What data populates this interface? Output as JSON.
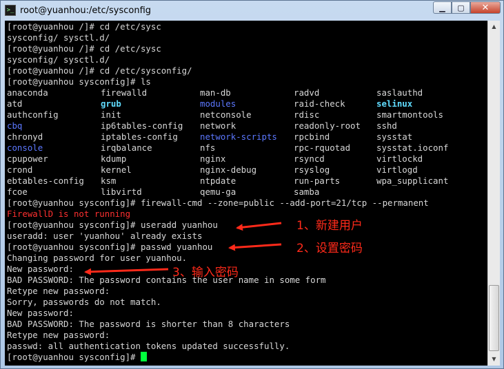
{
  "window": {
    "title": "root@yuanhou:/etc/sysconfig",
    "icon": "terminal-icon",
    "buttons": {
      "minimize": "▁",
      "maximize": "▢",
      "close": "✕"
    }
  },
  "terminal": {
    "lines_before_ls": [
      "[root@yuanhou /]# cd /etc/sysc",
      "sysconfig/ sysctl.d/",
      "[root@yuanhou /]# cd /etc/sysc",
      "sysconfig/ sysctl.d/",
      "[root@yuanhou /]# cd /etc/sysconfig/",
      "[root@yuanhou sysconfig]# ls"
    ],
    "ls_rows": [
      [
        "anaconda",
        "firewalld",
        "man-db",
        "radvd",
        "saslauthd"
      ],
      [
        "atd",
        "grub",
        "modules",
        "raid-check",
        "selinux"
      ],
      [
        "authconfig",
        "init",
        "netconsole",
        "rdisc",
        "smartmontools"
      ],
      [
        "cbq",
        "ip6tables-config",
        "network",
        "readonly-root",
        "sshd"
      ],
      [
        "chronyd",
        "iptables-config",
        "network-scripts",
        "rpcbind",
        "sysstat"
      ],
      [
        "console",
        "irqbalance",
        "nfs",
        "rpc-rquotad",
        "sysstat.ioconf"
      ],
      [
        "cpupower",
        "kdump",
        "nginx",
        "rsyncd",
        "virtlockd"
      ],
      [
        "crond",
        "kernel",
        "nginx-debug",
        "rsyslog",
        "virtlogd"
      ],
      [
        "ebtables-config",
        "ksm",
        "ntpdate",
        "run-parts",
        "wpa_supplicant"
      ],
      [
        "fcoe",
        "libvirtd",
        "qemu-ga",
        "samba",
        ""
      ]
    ],
    "ls_styles": {
      "grub": "bold-cyan",
      "modules": "dir",
      "selinux": "bold-cyan",
      "cbq": "dir",
      "network-scripts": "dir",
      "console": "dir"
    },
    "lines_after_ls": [
      {
        "text": "[root@yuanhou sysconfig]# firewall-cmd --zone=public --add-port=21/tcp --permanent",
        "style": ""
      },
      {
        "text": "FirewallD is not running",
        "style": "err"
      },
      {
        "text": "[root@yuanhou sysconfig]# useradd yuanhou",
        "style": ""
      },
      {
        "text": "useradd: user 'yuanhou' already exists",
        "style": ""
      },
      {
        "text": "[root@yuanhou sysconfig]# passwd yuanhou",
        "style": ""
      },
      {
        "text": "Changing password for user yuanhou.",
        "style": ""
      },
      {
        "text": "New password:",
        "style": ""
      },
      {
        "text": "BAD PASSWORD: The password contains the user name in some form",
        "style": ""
      },
      {
        "text": "Retype new password:",
        "style": ""
      },
      {
        "text": "Sorry, passwords do not match.",
        "style": ""
      },
      {
        "text": "New password:",
        "style": ""
      },
      {
        "text": "BAD PASSWORD: The password is shorter than 8 characters",
        "style": ""
      },
      {
        "text": "Retype new password:",
        "style": ""
      },
      {
        "text": "passwd: all authentication tokens updated successfully.",
        "style": ""
      }
    ],
    "prompt_final": "[root@yuanhou sysconfig]# ",
    "colors": {
      "background": "#000000",
      "text": "#d8d8d8",
      "directory": "#5c78ff",
      "bold_cyan": "#60dcff",
      "error": "#ff3030",
      "cursor": "#00ff3c"
    }
  },
  "annotations": {
    "a1": "1、新建用户",
    "a2": "2、设置密码",
    "a3": "3、输入密码",
    "color": "#ff2a1a"
  }
}
